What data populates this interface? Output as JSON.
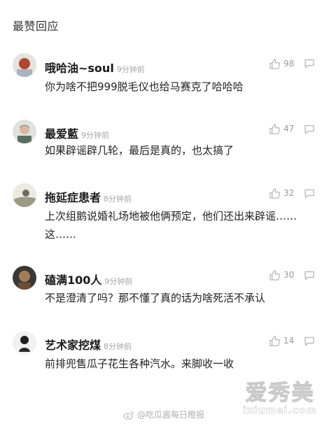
{
  "section": {
    "title": "最赞回应"
  },
  "icons": {
    "like": "thumbs-up-icon",
    "reply": "comment-bubble-icon",
    "footer": "weibo-logo-icon"
  },
  "colors": {
    "text": "#222222",
    "meta": "#a6a6a6",
    "icon": "#b5b5b5"
  },
  "comments": [
    {
      "name": "哦哈油~soul",
      "time": "9分钟前",
      "likes": "98",
      "text": "你为啥不把999脱毛仪也给马赛克了哈哈哈"
    },
    {
      "name": "最爱藍",
      "time": "9分钟前",
      "likes": "47",
      "text": "如果辟谣辟几轮，最后是真的，也太搞了"
    },
    {
      "name": "拖延症患者",
      "time": "8分钟前",
      "likes": "32",
      "text": "上次组鹅说婚礼场地被他俩预定，他们还出来辟谣……这……"
    },
    {
      "name": "磕满100人",
      "time": "9分钟前",
      "likes": "30",
      "text": "不是澄清了吗？那不懂了真的话为啥死活不承认"
    },
    {
      "name": "艺术家挖煤",
      "time": "8分钟前",
      "likes": "14",
      "text": "前排兜售瓜子花生各种汽水。来脚收一收"
    }
  ],
  "footer": {
    "text": "@吃瓜酱每日瞪报"
  },
  "watermark": {
    "main": "爱秀美",
    "sub": "ixiumei.com"
  }
}
